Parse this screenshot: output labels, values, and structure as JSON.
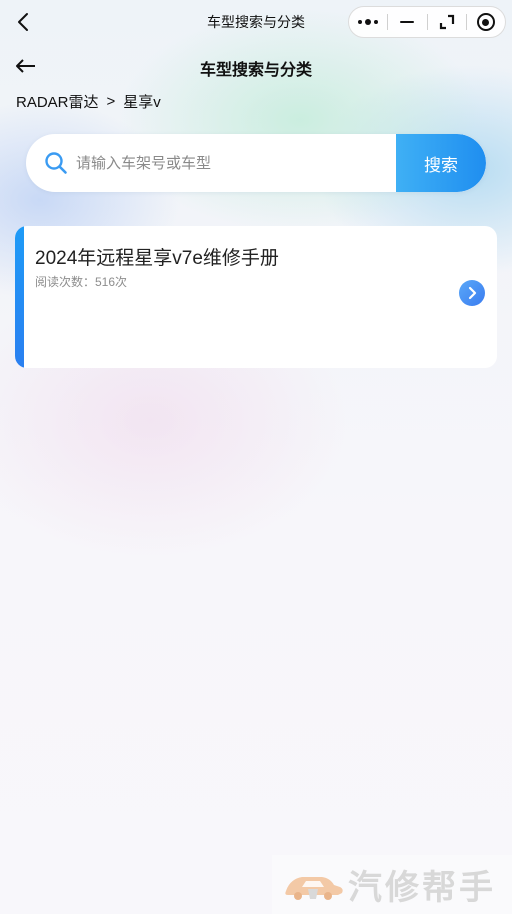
{
  "topbar": {
    "title": "车型搜索与分类",
    "icons": [
      "back-chevron-icon",
      "more-dots-icon",
      "minimize-icon",
      "rotate-icon",
      "close-target-icon"
    ]
  },
  "header": {
    "title": "车型搜索与分类",
    "back_icon": "left-arrow-icon"
  },
  "breadcrumb": {
    "items": [
      "RADAR雷达",
      "星享v"
    ],
    "separator": ">"
  },
  "search": {
    "value": "",
    "placeholder": "请输入车架号或车型",
    "button_label": "搜索",
    "accent": "#1f8ef0"
  },
  "results": [
    {
      "title": "2024年远程星享v7e维修手册",
      "meta": "阅读次数：516次",
      "icon": "chevron-right-icon"
    }
  ],
  "watermark": {
    "text": "汽修帮手",
    "logo_icon": "car-logo-icon"
  }
}
